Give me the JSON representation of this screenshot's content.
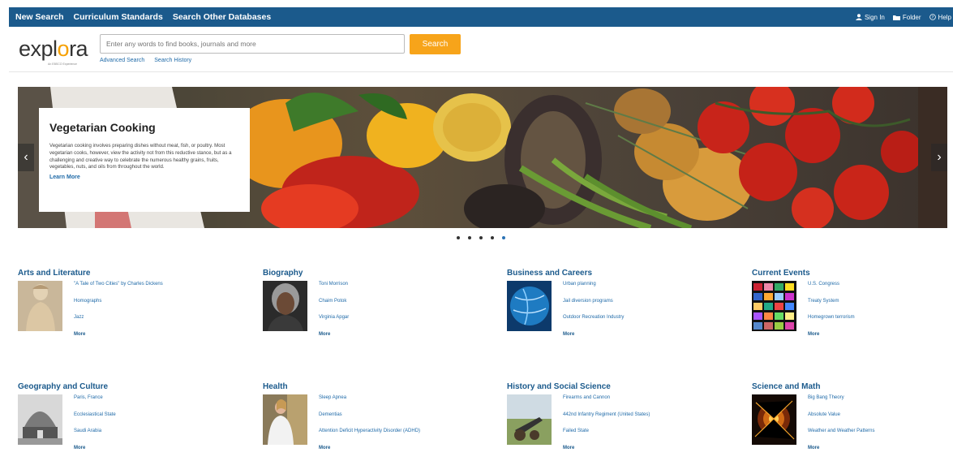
{
  "topbar": {
    "links": [
      "New Search",
      "Curriculum Standards",
      "Search Other Databases"
    ],
    "sign_in": "Sign In",
    "folder": "Folder",
    "help": "Help"
  },
  "header": {
    "logo_text": "explora",
    "logo_sub": "An EBSCO Experience",
    "search_placeholder": "Enter any words to find books, journals and more",
    "search_button": "Search",
    "advanced_search": "Advanced Search",
    "search_history": "Search History"
  },
  "hero": {
    "title": "Vegetarian Cooking",
    "description": "Vegetarian cooking involves preparing dishes without meat, fish, or poultry. Most vegetarian cooks, however, view the activity not from this reductive stance, but as a challenging and creative way to celebrate the numerous healthy grains, fruits, vegetables, nuts, and oils from throughout the world.",
    "link": "Learn More",
    "slides": 5,
    "active_slide": 5
  },
  "categories": [
    {
      "title": "Arts and Literature",
      "items": [
        "\"A Tale of Two Cities\" by Charles Dickens",
        "Homographs",
        "Jazz"
      ],
      "more": "More"
    },
    {
      "title": "Biography",
      "items": [
        "Toni Morrison",
        "Chaim Potok",
        "Virginia Apgar"
      ],
      "more": "More"
    },
    {
      "title": "Business and Careers",
      "items": [
        "Urban planning",
        "Jail diversion programs",
        "Outdoor Recreation Industry"
      ],
      "more": "More"
    },
    {
      "title": "Current Events",
      "items": [
        "U.S. Congress",
        "Treaty System",
        "Homegrown terrorism"
      ],
      "more": "More"
    },
    {
      "title": "Geography and Culture",
      "items": [
        "Paris, France",
        "Ecclesiastical State",
        "Saudi Arabia"
      ],
      "more": "More"
    },
    {
      "title": "Health",
      "items": [
        "Sleep Apnea",
        "Dementias",
        "Attention Deficit Hyperactivity Disorder (ADHD)"
      ],
      "more": "More"
    },
    {
      "title": "History and Social Science",
      "items": [
        "Firearms and Cannon",
        "442nd Infantry Regiment (United States)",
        "Failed State"
      ],
      "more": "More"
    },
    {
      "title": "Science and Math",
      "items": [
        "Big Bang Theory",
        "Absolute Value",
        "Weather and Weather Patterns"
      ],
      "more": "More"
    }
  ],
  "colors": {
    "topbar": "#1b5a8c",
    "accent": "#f7a41a",
    "link": "#1f6aa8"
  }
}
